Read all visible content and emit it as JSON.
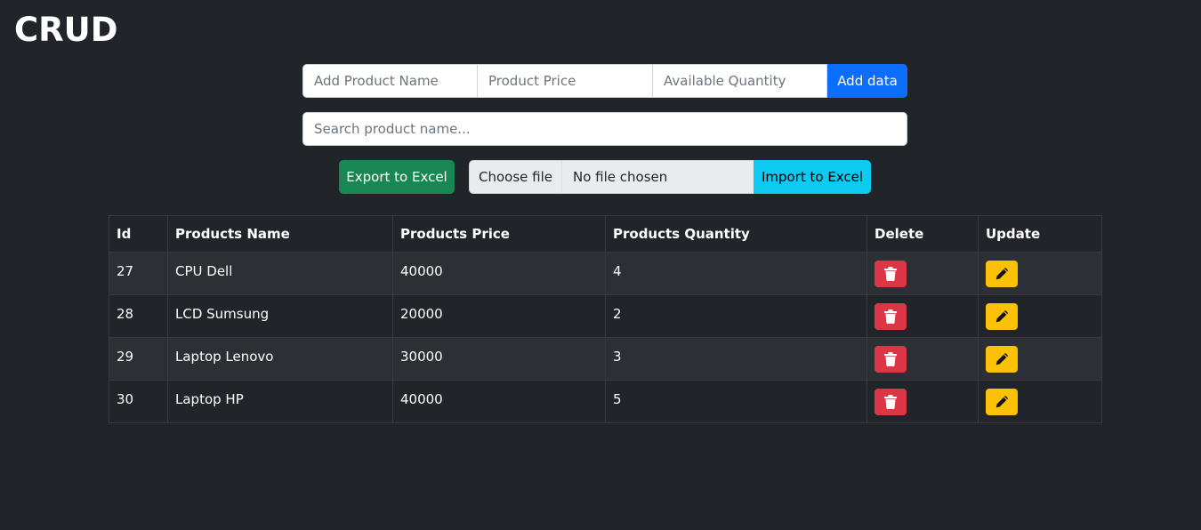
{
  "app": {
    "title": "CRUD"
  },
  "add_form": {
    "name_placeholder": "Add Product Name",
    "price_placeholder": "Product Price",
    "quantity_placeholder": "Available Quantity",
    "add_label": "Add data"
  },
  "search": {
    "placeholder": "Search product name..."
  },
  "toolbar": {
    "export_label": "Export to Excel",
    "choose_file_label": "Choose file",
    "file_status": "No file chosen",
    "import_label": "Import to Excel"
  },
  "table": {
    "headers": [
      "Id",
      "Products Name",
      "Products Price",
      "Products Quantity",
      "Delete",
      "Update"
    ],
    "rows": [
      {
        "id": "27",
        "name": "CPU Dell",
        "price": "40000",
        "quantity": "4"
      },
      {
        "id": "28",
        "name": "LCD Sumsung",
        "price": "20000",
        "quantity": "2"
      },
      {
        "id": "29",
        "name": "Laptop Lenovo",
        "price": "30000",
        "quantity": "3"
      },
      {
        "id": "30",
        "name": "Laptop HP",
        "price": "40000",
        "quantity": "5"
      }
    ],
    "delete_icon": "trash-icon",
    "update_icon": "pencil-icon"
  },
  "colors": {
    "background": "#212529",
    "primary": "#0d6efd",
    "success": "#198754",
    "info": "#0dcaf0",
    "danger": "#dc3545",
    "warning": "#ffc107"
  }
}
